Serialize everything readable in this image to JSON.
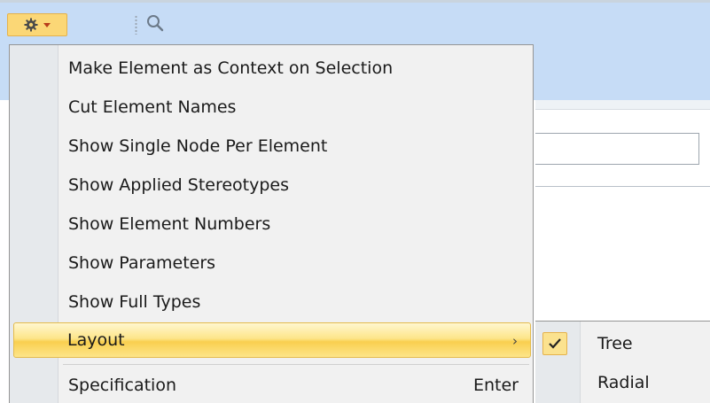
{
  "toolbar": {
    "options_icon": "gear-icon",
    "dropdown_icon": "caret-down-icon",
    "search_icon": "magnifier-icon"
  },
  "menu": {
    "items": [
      {
        "label": "Make Element as Context on Selection"
      },
      {
        "label": "Cut Element Names"
      },
      {
        "label": "Show Single Node Per Element"
      },
      {
        "label": "Show Applied Stereotypes"
      },
      {
        "label": "Show Element Numbers"
      },
      {
        "label": "Show Parameters"
      },
      {
        "label": "Show Full Types"
      },
      {
        "label": "Layout",
        "submenu_arrow": "›",
        "highlighted": true
      },
      {
        "label": "Specification",
        "shortcut": "Enter"
      }
    ]
  },
  "submenu": {
    "items": [
      {
        "label": "Tree",
        "checked": true
      },
      {
        "label": "Radial",
        "checked": false
      }
    ]
  },
  "colors": {
    "header_bg": "#c6dcf6",
    "highlight": "#fde58a",
    "menu_bg": "#f1f1f1"
  }
}
